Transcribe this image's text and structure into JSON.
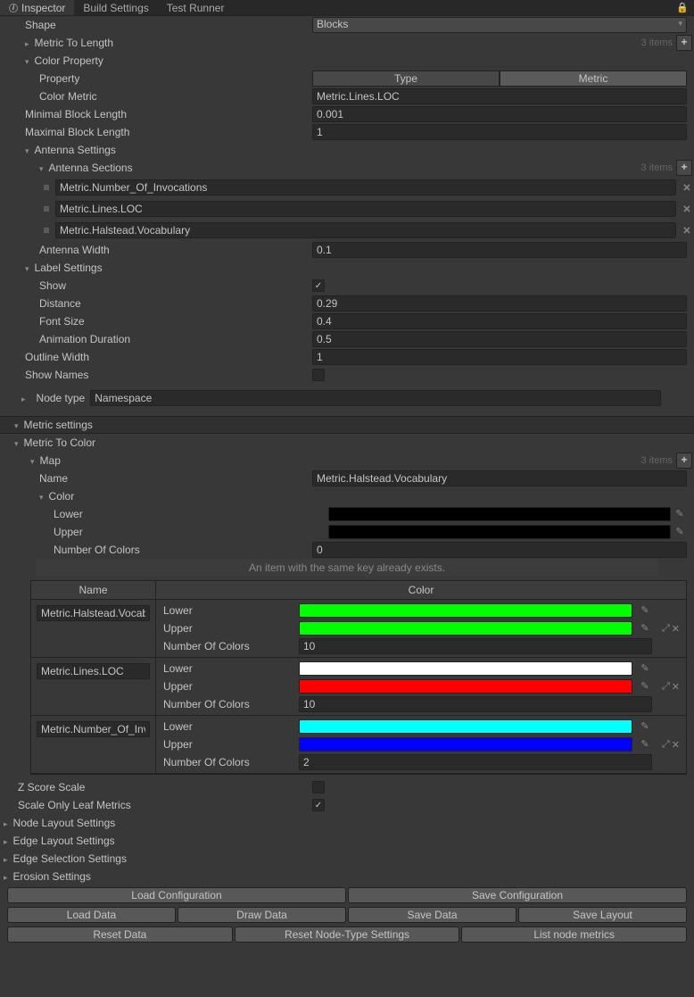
{
  "tabs": {
    "inspector": "Inspector",
    "build": "Build Settings",
    "test": "Test Runner"
  },
  "shape": {
    "label": "Shape",
    "value": "Blocks"
  },
  "metricToLength": {
    "label": "Metric To Length",
    "count": "3 items"
  },
  "colorProperty": {
    "header": "Color Property",
    "property": "Property",
    "type_btn": "Type",
    "metric_btn": "Metric",
    "colorMetricLabel": "Color Metric",
    "colorMetricValue": "Metric.Lines.LOC"
  },
  "minBlock": {
    "label": "Minimal Block Length",
    "value": "0.001"
  },
  "maxBlock": {
    "label": "Maximal Block Length",
    "value": "1"
  },
  "antenna": {
    "header": "Antenna Settings",
    "sectionsLabel": "Antenna Sections",
    "count": "3 items",
    "items": [
      "Metric.Number_Of_Invocations",
      "Metric.Lines.LOC",
      "Metric.Halstead.Vocabulary"
    ],
    "widthLabel": "Antenna Width",
    "widthValue": "0.1"
  },
  "labelSettings": {
    "header": "Label Settings",
    "showLabel": "Show",
    "showChecked": true,
    "distanceLabel": "Distance",
    "distanceValue": "0.29",
    "fontLabel": "Font Size",
    "fontValue": "0.4",
    "animLabel": "Animation Duration",
    "animValue": "0.5"
  },
  "outline": {
    "label": "Outline Width",
    "value": "1"
  },
  "showNames": {
    "label": "Show Names",
    "checked": false
  },
  "nodeType": {
    "label": "Node type",
    "value": "Namespace"
  },
  "metricSettings": {
    "header": "Metric settings"
  },
  "metricToColor": {
    "header": "Metric To Color",
    "mapLabel": "Map",
    "count": "3 items",
    "nameLabel": "Name",
    "nameValue": "Metric.Halstead.Vocabulary",
    "colorLabel": "Color",
    "lowerLabel": "Lower",
    "upperLabel": "Upper",
    "numColorsLabel": "Number Of Colors",
    "numColorsValue": "0",
    "warning": "An item with the same key already exists.",
    "tableHead": {
      "name": "Name",
      "color": "Color"
    },
    "rows": [
      {
        "name": "Metric.Halstead.Vocabulary",
        "lower": "#00ff00",
        "upper": "#00ff00",
        "num": "10"
      },
      {
        "name": "Metric.Lines.LOC",
        "lower": "#ffffff",
        "upper": "#ff0000",
        "num": "10"
      },
      {
        "name": "Metric.Number_Of_Invocations",
        "lower": "#00ffff",
        "upper": "#0000ff",
        "num": "2"
      }
    ]
  },
  "zscore": {
    "label": "Z Score Scale",
    "checked": false
  },
  "scaleLeaf": {
    "label": "Scale Only Leaf Metrics",
    "checked": true
  },
  "collapsed": {
    "nodeLayout": "Node Layout Settings",
    "edgeLayout": "Edge Layout Settings",
    "edgeSelection": "Edge Selection Settings",
    "erosion": "Erosion Settings"
  },
  "buttons": {
    "loadConfig": "Load Configuration",
    "saveConfig": "Save Configuration",
    "loadData": "Load Data",
    "drawData": "Draw Data",
    "saveData": "Save Data",
    "saveLayout": "Save Layout",
    "resetData": "Reset Data",
    "resetNodeType": "Reset Node-Type Settings",
    "listMetrics": "List node metrics"
  },
  "sub": {
    "lower": "Lower",
    "upper": "Upper",
    "num": "Number Of Colors"
  }
}
